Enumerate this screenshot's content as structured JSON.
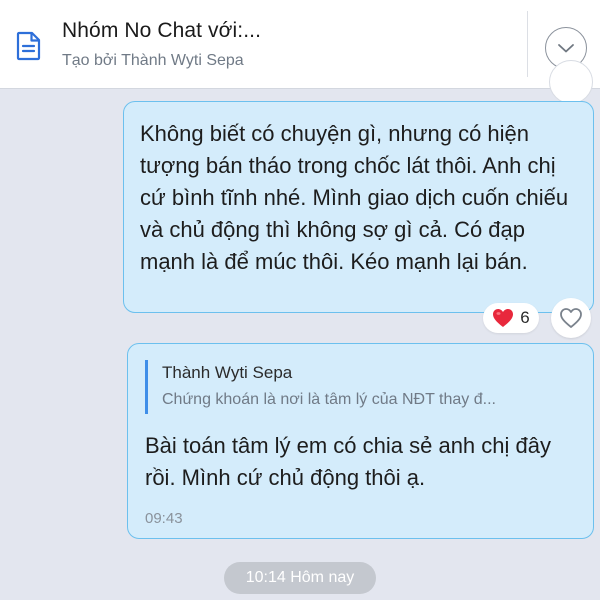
{
  "header": {
    "title": "Nhóm No Chat với:...",
    "subtitle": "Tạo bởi Thành Wyti Sepa",
    "doc_icon": "document-icon",
    "collapse_icon": "chevron-down-icon"
  },
  "messages": [
    {
      "text": "Không biết có chuyện gì, nhưng có hiện tượng bán tháo trong chốc lát thôi. Anh chị cứ bình tĩnh nhé. Mình giao dịch cuốn chiếu và chủ động thì không sợ gì cả. Có đạp mạnh là để múc thôi. Kéo mạnh lại bán.",
      "reaction": {
        "icon": "heart-emoji-icon",
        "count": "6"
      },
      "like_icon": "heart-outline-icon"
    },
    {
      "quote": {
        "author": "Thành Wyti Sepa",
        "text": "Chứng khoán là nơi là tâm lý của NĐT thay đ..."
      },
      "text": "Bài toán tâm lý em có chia sẻ anh chị đây rồi. Mình cứ chủ động thôi ạ.",
      "time": "09:43"
    }
  ],
  "date_separator": "10:14 Hôm nay",
  "colors": {
    "background": "#e3e6ef",
    "bubble": "#d4ecfb",
    "bubble_border": "#6cc0ee",
    "quote_bar": "#3f8ee8",
    "heart": "#e8283c"
  }
}
